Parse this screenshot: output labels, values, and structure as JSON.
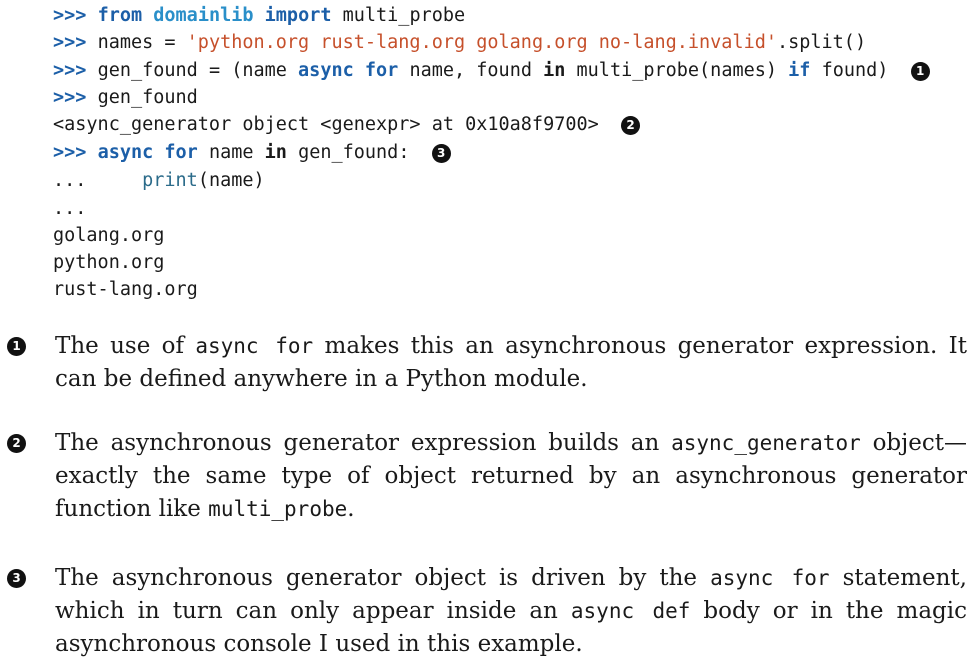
{
  "code": {
    "lines": [
      [
        {
          "t": "prompt",
          "v": ">>> "
        },
        {
          "t": "kw",
          "v": "from"
        },
        {
          "t": "plain",
          "v": " "
        },
        {
          "t": "mod",
          "v": "domainlib"
        },
        {
          "t": "plain",
          "v": " "
        },
        {
          "t": "kw",
          "v": "import"
        },
        {
          "t": "plain",
          "v": " multi_probe"
        }
      ],
      [
        {
          "t": "prompt",
          "v": ">>> "
        },
        {
          "t": "plain",
          "v": "names = "
        },
        {
          "t": "str",
          "v": "'python.org rust-lang.org golang.org no-lang.invalid'"
        },
        {
          "t": "plain",
          "v": ".split()"
        }
      ],
      [
        {
          "t": "prompt",
          "v": ">>> "
        },
        {
          "t": "plain",
          "v": "gen_found = (name "
        },
        {
          "t": "kw",
          "v": "async"
        },
        {
          "t": "plain",
          "v": " "
        },
        {
          "t": "kw",
          "v": "for"
        },
        {
          "t": "plain",
          "v": " name, found "
        },
        {
          "t": "kwb",
          "v": "in"
        },
        {
          "t": "plain",
          "v": " multi_probe(names) "
        },
        {
          "t": "kw",
          "v": "if"
        },
        {
          "t": "plain",
          "v": " found)  "
        },
        {
          "t": "callout",
          "v": "1"
        }
      ],
      [
        {
          "t": "prompt",
          "v": ">>> "
        },
        {
          "t": "plain",
          "v": "gen_found"
        }
      ],
      [
        {
          "t": "plain",
          "v": "<async_generator object <genexpr> at 0x10a8f9700>  "
        },
        {
          "t": "callout",
          "v": "2"
        }
      ],
      [
        {
          "t": "prompt",
          "v": ">>> "
        },
        {
          "t": "kw",
          "v": "async"
        },
        {
          "t": "plain",
          "v": " "
        },
        {
          "t": "kw",
          "v": "for"
        },
        {
          "t": "plain",
          "v": " name "
        },
        {
          "t": "kwb",
          "v": "in"
        },
        {
          "t": "plain",
          "v": " gen_found:  "
        },
        {
          "t": "callout",
          "v": "3"
        }
      ],
      [
        {
          "t": "cont",
          "v": "...     "
        },
        {
          "t": "builtin",
          "v": "print"
        },
        {
          "t": "plain",
          "v": "(name)"
        }
      ],
      [
        {
          "t": "cont",
          "v": "..."
        }
      ],
      [
        {
          "t": "plain",
          "v": "golang.org"
        }
      ],
      [
        {
          "t": "plain",
          "v": "python.org"
        }
      ],
      [
        {
          "t": "plain",
          "v": "rust-lang.org"
        }
      ]
    ]
  },
  "notes": [
    {
      "marker": "1",
      "parts": [
        {
          "t": "text",
          "v": "The use of "
        },
        {
          "t": "code",
          "v": "async for"
        },
        {
          "t": "text",
          "v": " makes this an asynchronous generator expression. It can be defined anywhere in a Python module."
        }
      ]
    },
    {
      "marker": "2",
      "parts": [
        {
          "t": "text",
          "v": "The asynchronous generator expression builds an "
        },
        {
          "t": "code",
          "v": "async_generator"
        },
        {
          "t": "text",
          "v": " object—exactly the same type of object returned by an asynchronous generator function like "
        },
        {
          "t": "code",
          "v": "multi_probe"
        },
        {
          "t": "text",
          "v": "."
        }
      ]
    },
    {
      "marker": "3",
      "parts": [
        {
          "t": "text",
          "v": "The asynchronous generator object is driven by the "
        },
        {
          "t": "code",
          "v": "async for"
        },
        {
          "t": "text",
          "v": " statement, which in turn can only appear inside an "
        },
        {
          "t": "code",
          "v": "async def"
        },
        {
          "t": "text",
          "v": " body or in the magic asynchronous console I used in this example."
        }
      ]
    }
  ]
}
